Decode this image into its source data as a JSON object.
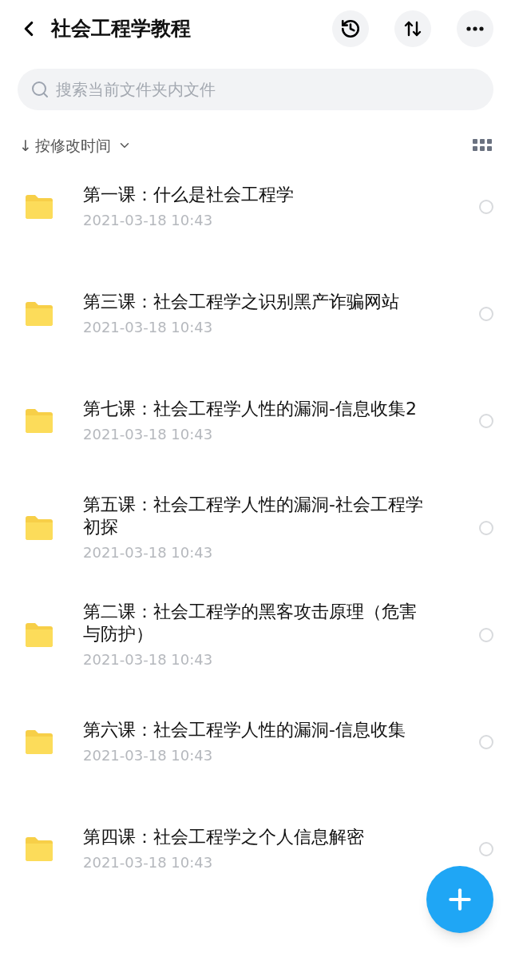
{
  "header": {
    "title": "社会工程学教程"
  },
  "search": {
    "placeholder": "搜索当前文件夹内文件"
  },
  "sort": {
    "arrow": "↓",
    "label": "按修改时间"
  },
  "files": [
    {
      "name": "第一课：什么是社会工程学",
      "date": "2021-03-18 10:43",
      "selected": false
    },
    {
      "name": "第三课：社会工程学之识别黑产诈骗网站",
      "date": "2021-03-18 10:43",
      "selected": false
    },
    {
      "name": "第七课：社会工程学人性的漏洞-信息收集2",
      "date": "2021-03-18 10:43",
      "selected": false
    },
    {
      "name": "第五课：社会工程学人性的漏洞-社会工程学初探",
      "date": "2021-03-18 10:43",
      "selected": false
    },
    {
      "name": "第二课：社会工程学的黑客攻击原理（危害与防护）",
      "date": "2021-03-18 10:43",
      "selected": false
    },
    {
      "name": "第六课：社会工程学人性的漏洞-信息收集",
      "date": "2021-03-18 10:43",
      "selected": false
    },
    {
      "name": "第四课：社会工程学之个人信息解密",
      "date": "2021-03-18 10:43",
      "selected": false
    }
  ]
}
